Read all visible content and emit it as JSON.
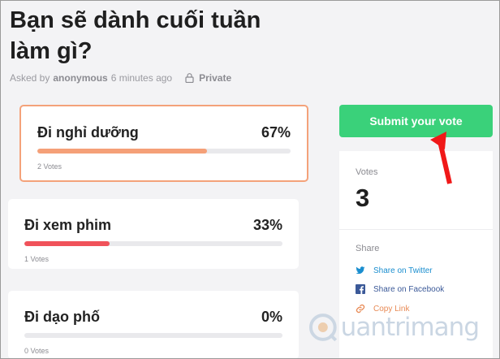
{
  "poll": {
    "title": "Bạn sẽ dành cuối tuần làm gì?",
    "asked_by_prefix": "Asked by",
    "asked_by_user": "anonymous",
    "asked_time": "6 minutes ago",
    "visibility": "Private"
  },
  "options": [
    {
      "label": "Đi nghỉ dưỡng",
      "percent_text": "67%",
      "percent": 67,
      "votes_text": "2 Votes",
      "bar_color": "#f5a078",
      "selected": true
    },
    {
      "label": "Đi xem phim",
      "percent_text": "33%",
      "percent": 33,
      "votes_text": "1 Votes",
      "bar_color": "#f0525a",
      "selected": false
    },
    {
      "label": "Đi dạo phố",
      "percent_text": "0%",
      "percent": 0,
      "votes_text": "0 Votes",
      "bar_color": "#cfcfd4",
      "selected": false
    }
  ],
  "submit": {
    "label": "Submit your vote",
    "color": "#3ad17a"
  },
  "stats": {
    "votes_label": "Votes",
    "votes_count": "3",
    "share_label": "Share",
    "share_twitter": "Share on Twitter",
    "share_facebook": "Share on Facebook",
    "copy_link": "Copy Link"
  },
  "watermark": {
    "text": "uantrimang",
    "icon": "watermark-logo-icon"
  },
  "icons": [
    "lock-icon",
    "twitter-icon",
    "facebook-icon",
    "link-icon",
    "red-arrow-icon"
  ]
}
